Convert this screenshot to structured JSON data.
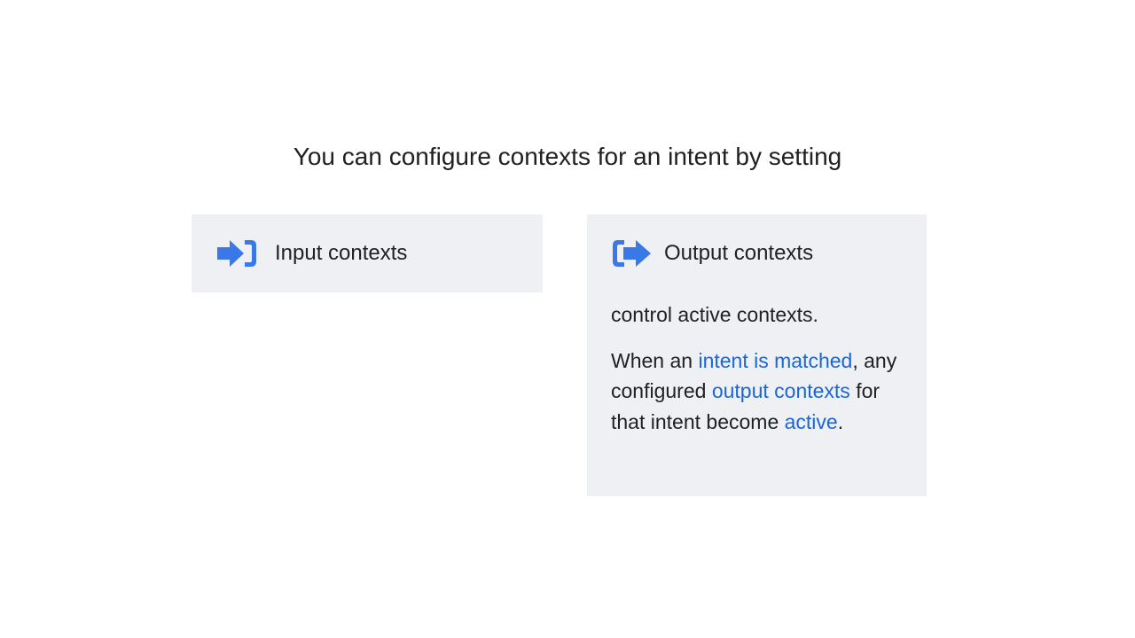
{
  "title": "You can configure contexts for an intent by setting",
  "cards": {
    "input": {
      "icon": "login-arrow-icon",
      "label": "Input contexts"
    },
    "output": {
      "icon": "logout-arrow-icon",
      "label": "Output contexts",
      "line1": "control active contexts.",
      "p2": {
        "t1": "When an ",
        "h1": "intent is matched",
        "t2": ", any configured ",
        "h2": "output contexts",
        "t3": " for that intent become ",
        "h3": "active",
        "t4": "."
      }
    }
  },
  "colors": {
    "icon_blue": "#3b78e7",
    "highlight_blue": "#1a66d9",
    "card_bg": "#eef0f3",
    "text": "#202124"
  }
}
